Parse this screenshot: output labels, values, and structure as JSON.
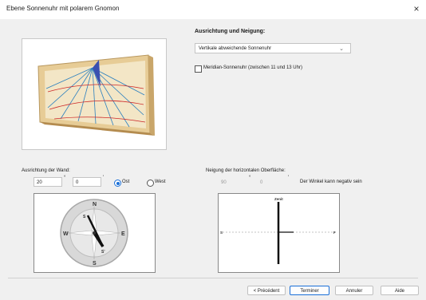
{
  "window": {
    "title": "Ebene Sonnenuhr mit polarem Gnomon",
    "close_symbol": "×"
  },
  "orientation": {
    "heading": "Ausrichtung und Neigung:",
    "type_selected": "Vertikale abweichende Sonnenuhr",
    "meridian_checkbox_label": "Meridian-Sonnenuhr (zwischen 11 und 13 Uhr)",
    "meridian_checked": false
  },
  "wall": {
    "label": "Ausrichtung der Wand:",
    "degrees": "20",
    "minutes": "0",
    "deg_unit": "°",
    "min_unit": "'",
    "east_label": "Ost",
    "west_label": "West",
    "selected": "Ost",
    "compass": {
      "n": "N",
      "s": "S",
      "e": "E",
      "w": "W",
      "inner_s": "S",
      "inner_s2": "S'"
    }
  },
  "inclination": {
    "label": "Neigung der horizontalen Oberfläche:",
    "degrees": "90",
    "minutes": "0",
    "deg_unit": "°",
    "min_unit": "'",
    "note": "Der Winkel kann negativ sein",
    "zenith": "Zenit",
    "left_mark": "S",
    "right_mark": "F"
  },
  "buttons": {
    "prev": "< Précédent",
    "finish": "Terminer",
    "cancel": "Annuler",
    "help": "Aide"
  },
  "colors": {
    "accent": "#1a6fd8",
    "wood": "#e7cc96",
    "hour_lines": "#2a7fbf",
    "date_lines": "#cc2a2a"
  }
}
